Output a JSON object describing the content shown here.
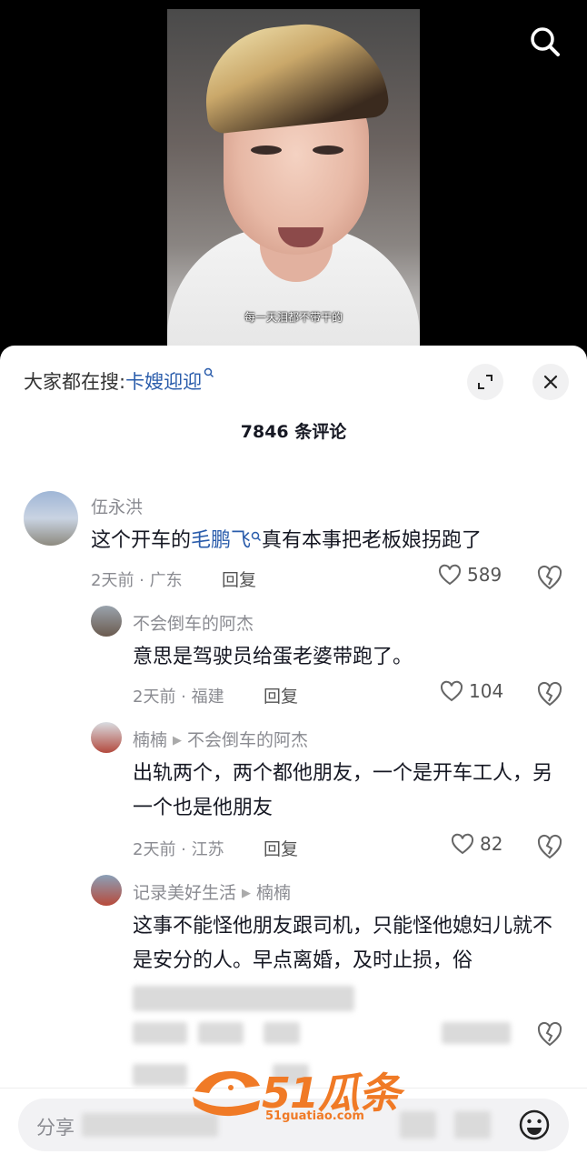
{
  "video": {
    "subtitle": "每一天泪都不带干的"
  },
  "header": {
    "prefix": "大家都在搜:",
    "keyword": "卡嫂迎迎",
    "count_label": "7846 条评论"
  },
  "comments": [
    {
      "user": "伍永洪",
      "text_before": "这个开车的",
      "link": "毛鹏飞",
      "text_after": "真有本事把老板娘拐跑了",
      "meta": "2天前 · 广东",
      "reply": "回复",
      "likes": "589"
    },
    {
      "user": "不会倒车的阿杰",
      "text": "意思是驾驶员给蛋老婆带跑了。",
      "meta": "2天前 · 福建",
      "reply": "回复",
      "likes": "104"
    },
    {
      "user": "楠楠",
      "reply_to": "不会倒车的阿杰",
      "text": "出轨两个，两个都他朋友，一个是开车工人，另一个也是他朋友",
      "meta": "2天前 · 江苏",
      "reply": "回复",
      "likes": "82"
    },
    {
      "user": "记录美好生活",
      "reply_to": "楠楠",
      "text": "这事不能怪他朋友跟司机，只能怪他媳妇儿就不是安分的人。早点离婚，及时止损，俗"
    }
  ],
  "input": {
    "placeholder": "分享"
  },
  "watermark": {
    "brand": "51瓜条",
    "url": "51guatiao.com"
  },
  "colors": {
    "link": "#2a5cab",
    "watermark": "#f07a26"
  }
}
